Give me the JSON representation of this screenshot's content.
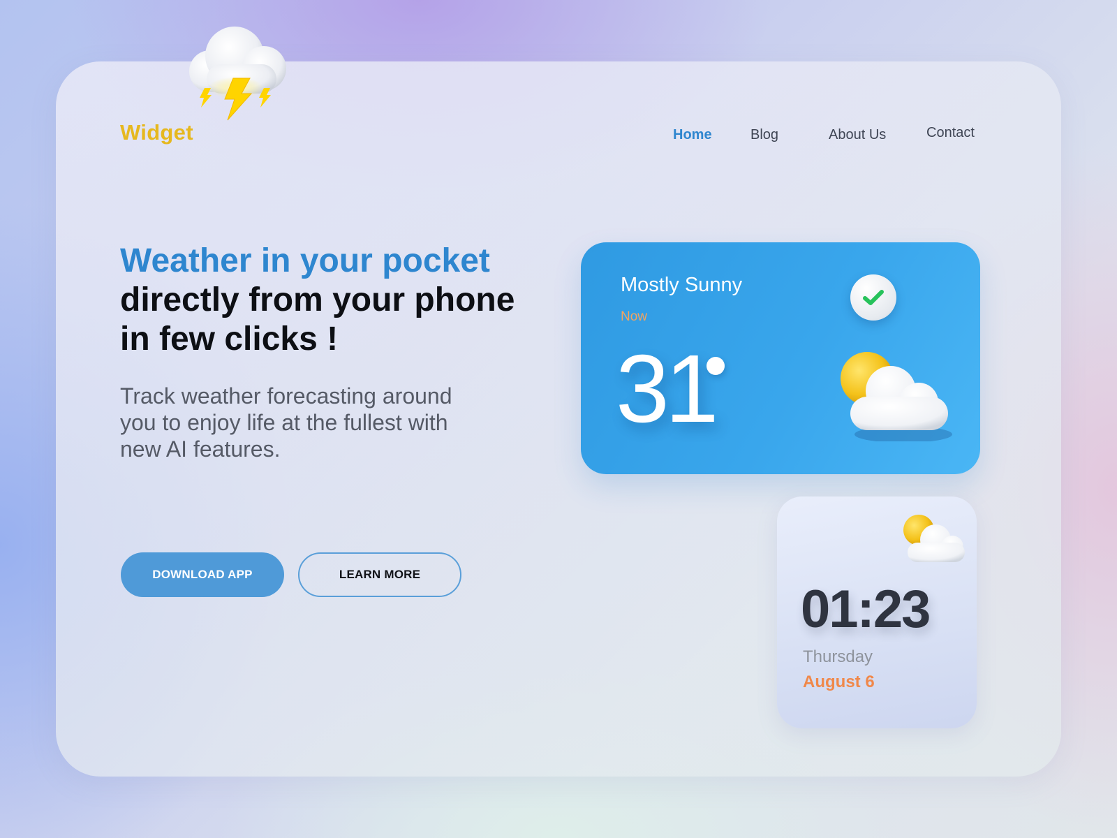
{
  "brand": {
    "name": "Widget"
  },
  "nav": {
    "items": [
      "Home",
      "Blog",
      "About Us",
      "Contact"
    ],
    "active": "Home"
  },
  "hero": {
    "title_highlight": "Weather in your pocket",
    "title_rest": "directly from your phone in few clicks !",
    "subtitle": "Track weather forecasting around you to enjoy life at the fullest with new AI features."
  },
  "actions": {
    "primary_label": "DOWNLOAD APP",
    "secondary_label": "LEARN MORE"
  },
  "weather_widget": {
    "condition": "Mostly Sunny",
    "time_label": "Now",
    "temperature": "31",
    "status_icon": "check-icon",
    "weather_icon": "partly-sunny-icon"
  },
  "clock_widget": {
    "time": "01:23",
    "day": "Thursday",
    "date": "August 6",
    "weather_icon": "partly-sunny-icon"
  },
  "decor": {
    "icon": "thunderstorm-icon"
  },
  "colors": {
    "accent_blue": "#2e86cf",
    "logo_yellow": "#e6b81f",
    "orange": "#f0884a",
    "card_blue": "#39a6ec"
  }
}
